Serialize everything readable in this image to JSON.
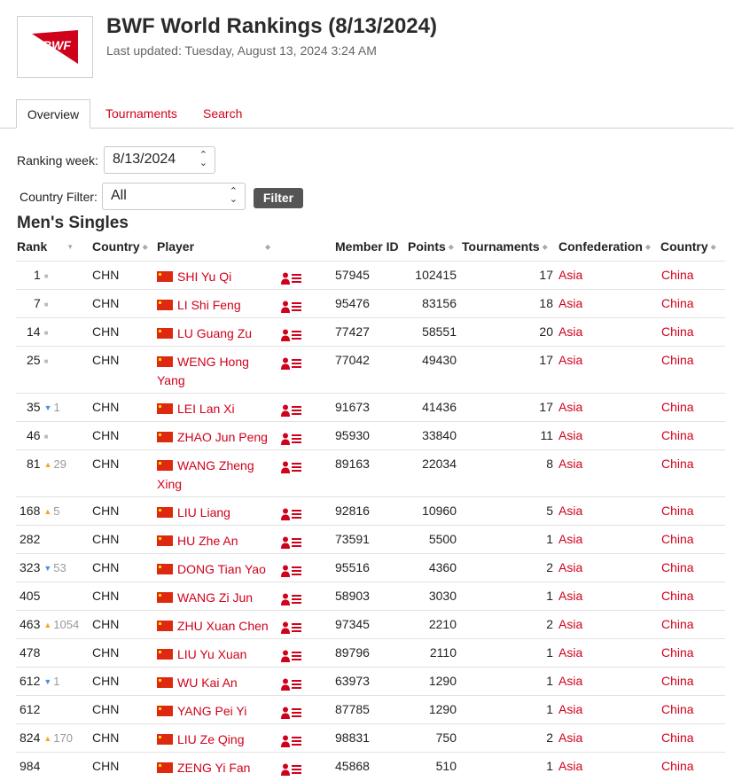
{
  "header": {
    "logo_text": "BWF",
    "title": "BWF World Rankings (8/13/2024)",
    "last_updated": "Last updated: Tuesday, August 13, 2024 3:24 AM"
  },
  "tabs": [
    {
      "label": "Overview",
      "active": true
    },
    {
      "label": "Tournaments",
      "active": false
    },
    {
      "label": "Search",
      "active": false
    }
  ],
  "filters": {
    "ranking_week_label": "Ranking week:",
    "ranking_week_value": "8/13/2024",
    "country_filter_label": "Country Filter:",
    "country_filter_value": "All",
    "filter_button": "Filter"
  },
  "section_title": "Men's Singles",
  "columns": [
    "Rank",
    "Country",
    "Player",
    "Member ID",
    "Points",
    "Tournaments",
    "Confederation",
    "Country"
  ],
  "colors": {
    "accent": "#d0021b",
    "up": "#f5a623",
    "down": "#4a90e2"
  },
  "rows": [
    {
      "rank": "1",
      "move": "none",
      "move_by": "",
      "country_code": "CHN",
      "player": "SHI Yu Qi",
      "member_id": "57945",
      "points": "102415",
      "tournaments": "17",
      "confederation": "Asia",
      "country": "China"
    },
    {
      "rank": "7",
      "move": "none",
      "move_by": "",
      "country_code": "CHN",
      "player": "LI Shi Feng",
      "member_id": "95476",
      "points": "83156",
      "tournaments": "18",
      "confederation": "Asia",
      "country": "China"
    },
    {
      "rank": "14",
      "move": "none",
      "move_by": "",
      "country_code": "CHN",
      "player": "LU Guang Zu",
      "member_id": "77427",
      "points": "58551",
      "tournaments": "20",
      "confederation": "Asia",
      "country": "China"
    },
    {
      "rank": "25",
      "move": "none",
      "move_by": "",
      "country_code": "CHN",
      "player": "WENG Hong Yang",
      "member_id": "77042",
      "points": "49430",
      "tournaments": "17",
      "confederation": "Asia",
      "country": "China"
    },
    {
      "rank": "35",
      "move": "down",
      "move_by": "1",
      "country_code": "CHN",
      "player": "LEI Lan Xi",
      "member_id": "91673",
      "points": "41436",
      "tournaments": "17",
      "confederation": "Asia",
      "country": "China"
    },
    {
      "rank": "46",
      "move": "none",
      "move_by": "",
      "country_code": "CHN",
      "player": "ZHAO Jun Peng",
      "member_id": "95930",
      "points": "33840",
      "tournaments": "11",
      "confederation": "Asia",
      "country": "China"
    },
    {
      "rank": "81",
      "move": "up",
      "move_by": "29",
      "country_code": "CHN",
      "player": "WANG Zheng Xing",
      "member_id": "89163",
      "points": "22034",
      "tournaments": "8",
      "confederation": "Asia",
      "country": "China"
    },
    {
      "rank": "168",
      "move": "up",
      "move_by": "5",
      "country_code": "CHN",
      "player": "LIU Liang",
      "member_id": "92816",
      "points": "10960",
      "tournaments": "5",
      "confederation": "Asia",
      "country": "China"
    },
    {
      "rank": "282",
      "move": "",
      "move_by": "",
      "country_code": "CHN",
      "player": "HU Zhe An",
      "member_id": "73591",
      "points": "5500",
      "tournaments": "1",
      "confederation": "Asia",
      "country": "China"
    },
    {
      "rank": "323",
      "move": "down",
      "move_by": "53",
      "country_code": "CHN",
      "player": "DONG Tian Yao",
      "member_id": "95516",
      "points": "4360",
      "tournaments": "2",
      "confederation": "Asia",
      "country": "China"
    },
    {
      "rank": "405",
      "move": "",
      "move_by": "",
      "country_code": "CHN",
      "player": "WANG Zi Jun",
      "member_id": "58903",
      "points": "3030",
      "tournaments": "1",
      "confederation": "Asia",
      "country": "China"
    },
    {
      "rank": "463",
      "move": "up",
      "move_by": "1054",
      "country_code": "CHN",
      "player": "ZHU Xuan Chen",
      "member_id": "97345",
      "points": "2210",
      "tournaments": "2",
      "confederation": "Asia",
      "country": "China"
    },
    {
      "rank": "478",
      "move": "",
      "move_by": "",
      "country_code": "CHN",
      "player": "LIU Yu Xuan",
      "member_id": "89796",
      "points": "2110",
      "tournaments": "1",
      "confederation": "Asia",
      "country": "China"
    },
    {
      "rank": "612",
      "move": "down",
      "move_by": "1",
      "country_code": "CHN",
      "player": "WU Kai An",
      "member_id": "63973",
      "points": "1290",
      "tournaments": "1",
      "confederation": "Asia",
      "country": "China"
    },
    {
      "rank": "612",
      "move": "",
      "move_by": "",
      "country_code": "CHN",
      "player": "YANG Pei Yi",
      "member_id": "87785",
      "points": "1290",
      "tournaments": "1",
      "confederation": "Asia",
      "country": "China"
    },
    {
      "rank": "824",
      "move": "up",
      "move_by": "170",
      "country_code": "CHN",
      "player": "LIU Ze Qing",
      "member_id": "98831",
      "points": "750",
      "tournaments": "2",
      "confederation": "Asia",
      "country": "China"
    },
    {
      "rank": "984",
      "move": "",
      "move_by": "",
      "country_code": "CHN",
      "player": "ZENG Yi Fan",
      "member_id": "45868",
      "points": "510",
      "tournaments": "1",
      "confederation": "Asia",
      "country": "China"
    }
  ]
}
